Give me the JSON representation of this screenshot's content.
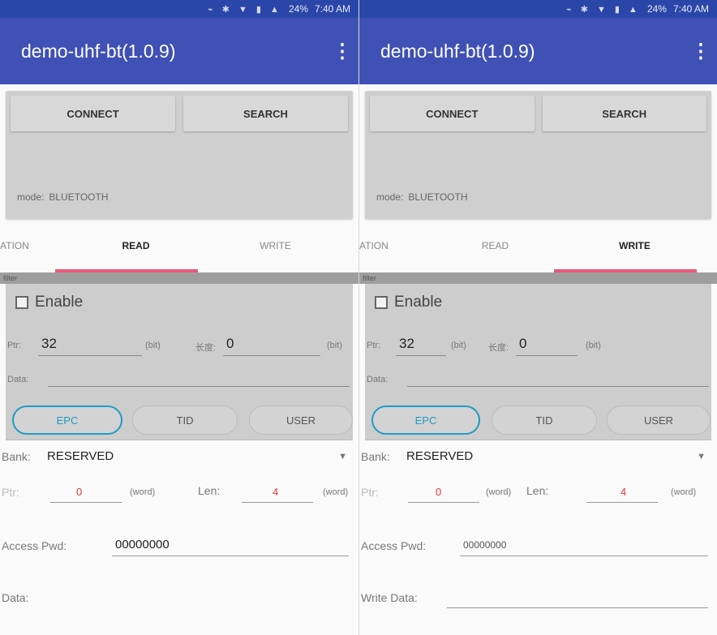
{
  "status": {
    "icons": "⌁ ✱ ▼ ▮ ▲",
    "battery": "24%",
    "time": "7:40 AM"
  },
  "appbar": {
    "title": "demo-uhf-bt(1.0.9)",
    "menu_icon": "more-vert-icon"
  },
  "connect_panel": {
    "connect_label": "CONNECT",
    "search_label": "SEARCH",
    "mode_label": "mode:",
    "mode_value": "BLUETOOTH"
  },
  "tabs": {
    "left_partial": "ATION",
    "read": "READ",
    "write": "WRITE",
    "left_active": "read",
    "right_active": "write"
  },
  "filter": {
    "bar_label": "filter",
    "enable_label": "Enable",
    "ptr_label": "Ptr:",
    "ptr_value": "32",
    "bit_unit": "(bit)",
    "len_label": "长度:",
    "len_value": "0",
    "data_label": "Data:",
    "banks": [
      "EPC",
      "TID",
      "USER"
    ],
    "selected_bank": "EPC"
  },
  "read_form": {
    "bank_label": "Bank:",
    "bank_value": "RESERVED",
    "ptr_label": "Ptr:",
    "ptr_value": "0",
    "word_unit": "(word)",
    "len_label": "Len:",
    "len_value": "4",
    "pwd_label": "Access Pwd:",
    "pwd_value": "00000000",
    "data_label": "Data:"
  },
  "write_form": {
    "bank_label": "Bank:",
    "bank_value": "RESERVED",
    "ptr_label": "Ptr:",
    "ptr_value": "0",
    "word_unit": "(word)",
    "len_label": "Len:",
    "len_value": "4",
    "pwd_label": "Access Pwd:",
    "pwd_value": "00000000",
    "data_label": "Write Data:"
  },
  "colors": {
    "appbar": "#3f51b5",
    "statusbar": "#2a46a8",
    "tab_indicator": "#e75a7c",
    "selected_segment": "#1f9cc3",
    "value_red": "#e53935"
  }
}
